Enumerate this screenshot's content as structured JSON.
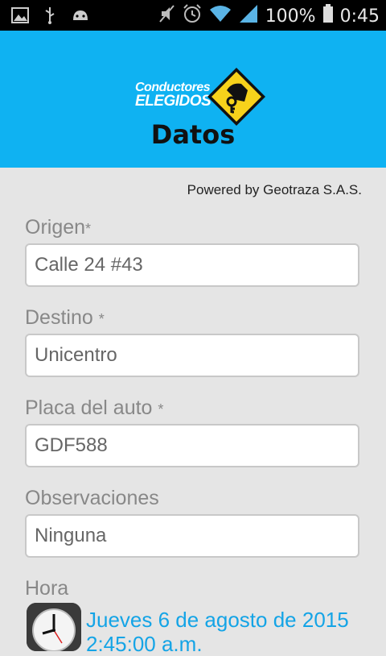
{
  "status_bar": {
    "battery": "100%",
    "time": "0:45",
    "left_icons": [
      "image-icon",
      "usb-icon",
      "android-icon"
    ],
    "right_icons": [
      "mute-icon",
      "alarm-icon",
      "wifi-icon",
      "signal-icon",
      "battery-icon"
    ]
  },
  "header": {
    "logo_line1": "Conductores",
    "logo_line2": "ELEGIDOS",
    "title": "Datos",
    "bg_color": "#0fb2f2"
  },
  "powered_by": "Powered by Geotraza S.A.S.",
  "form": {
    "origen_label": "Origen",
    "origen_value": "Calle 24 #43",
    "destino_label": "Destino",
    "destino_value": "Unicentro",
    "placa_label": "Placa del auto",
    "placa_value": "GDF588",
    "obs_label": "Observaciones",
    "obs_value": "Ninguna",
    "hora_label": "Hora",
    "required_mark": "*",
    "hora_date": "Jueves 6 de agosto de 2015",
    "hora_time": "2:45:00 a.m."
  }
}
